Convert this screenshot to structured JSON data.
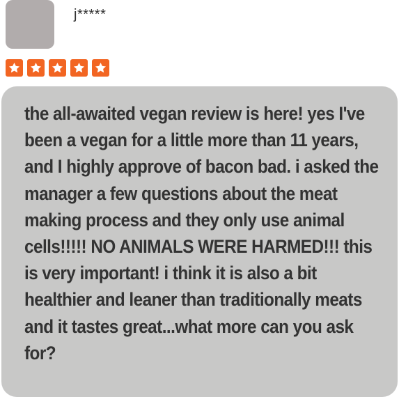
{
  "reviewer": {
    "username": "j*****"
  },
  "rating": {
    "value": 5,
    "max": 5,
    "star_color": "#f26522",
    "star_icon": "star-icon"
  },
  "review": {
    "text": "the all-awaited vegan review is here! yes I've been a vegan for a little more than 11 years, and I highly approve of bacon bad. i asked the manager a few questions about the meat making process and they only use animal cells!!!!! NO ANIMALS WERE HARMED!!! this is very important! i think it is also a bit healthier and leaner than traditionally meats and it tastes great...what more can you ask for?"
  }
}
